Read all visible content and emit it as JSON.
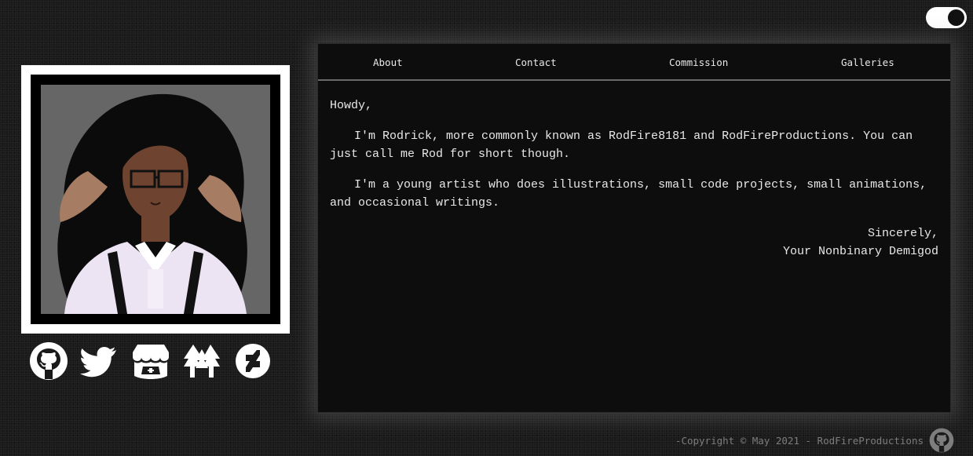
{
  "theme_toggle": {
    "state": "dark"
  },
  "portrait": {
    "alt": ""
  },
  "socials": [
    {
      "icon": "github-icon"
    },
    {
      "icon": "twitter-icon"
    },
    {
      "icon": "itchio-icon"
    },
    {
      "icon": "furaffinity-icon"
    },
    {
      "icon": "deviantart-icon"
    }
  ],
  "nav": {
    "about": "About",
    "contact": "Contact",
    "commission": "Commission",
    "galleries": "Galleries"
  },
  "content": {
    "greeting": "Howdy,",
    "para1": "I'm Rodrick, more commonly known as RodFire8181 and RodFireProductions. You can just call me Rod for short though.",
    "para2": "I'm a young artist who does illustrations, small code projects, small animations, and occasional writings.",
    "signoff1": "Sincerely,",
    "signoff2": "Your Nonbinary Demigod"
  },
  "footer": {
    "copyright": "-Copyright © May 2021 - RodFireProductions",
    "icon": "github-icon"
  },
  "colors": {
    "background": "#1a1a1a",
    "panel": "#0d0d0d",
    "text": "#e8e8e8",
    "footer_text": "#7d7d7d"
  }
}
